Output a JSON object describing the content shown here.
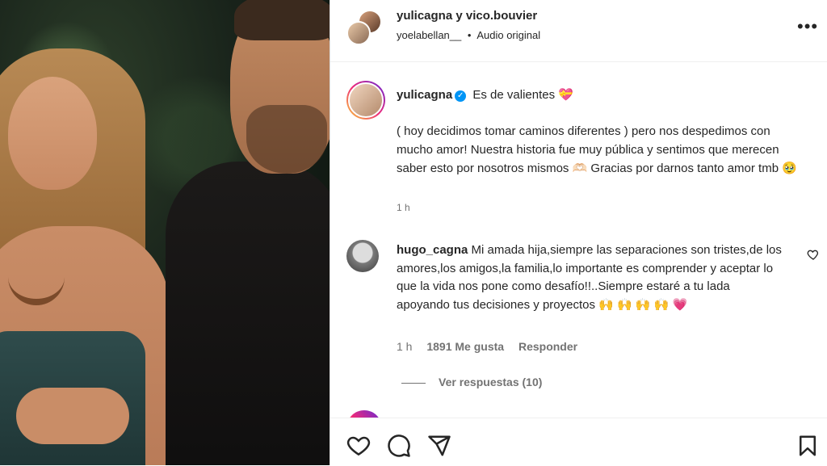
{
  "header": {
    "title": "yulicagna y vico.bouvier",
    "sub_user": "yoelabellan__",
    "sub_sep": "•",
    "sub_audio": "Audio original",
    "more": "•••"
  },
  "caption": {
    "user": "yulicagna",
    "first_line": "Es de valientes 💝",
    "text": "( hoy decidimos tomar caminos diferentes ) pero nos despedimos con mucho amor! Nuestra historia fue muy pública y sentimos que merecen saber esto por nosotros mismos 🫶🏻 Gracias por darnos tanto amor tmb 🥹",
    "time": "1 h"
  },
  "comment": {
    "user": "hugo_cagna",
    "text": "Mi amada hija,siempre las separaciones son tristes,de los amores,los amigos,la familia,lo importante es comprender y aceptar lo que la vida nos pone como desafío!!..Siempre estaré a tu lada apoyando tus decisiones y proyectos 🙌 🙌 🙌 🙌 💗",
    "time": "1 h",
    "likes": "1891 Me gusta",
    "reply": "Responder"
  },
  "replies": {
    "label": "Ver respuestas (10)"
  },
  "icons": {
    "like": "heart-icon",
    "comment": "comment-icon",
    "share": "share-icon",
    "save": "bookmark-icon",
    "more": "more-icon"
  },
  "colors": {
    "verified": "#0095f6",
    "muted": "#737373",
    "text": "#262626"
  }
}
